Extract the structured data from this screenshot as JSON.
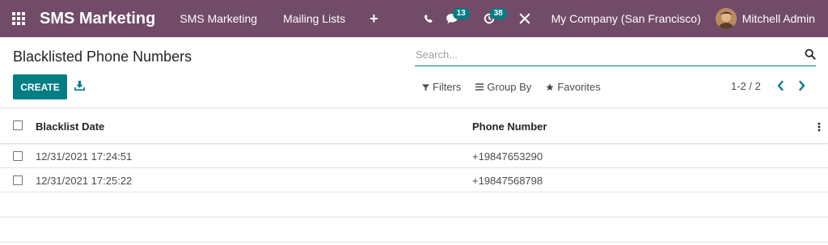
{
  "navbar": {
    "app_title": "SMS Marketing",
    "menu": [
      "SMS Marketing",
      "Mailing Lists"
    ],
    "plus_label": "+",
    "messages_count": "13",
    "activities_count": "38",
    "company": "My Company (San Francisco)",
    "user_name": "Mitchell Admin"
  },
  "control_panel": {
    "title": "Blacklisted Phone Numbers",
    "search_placeholder": "Search...",
    "create_label": "CREATE",
    "filters_label": "Filters",
    "group_by_label": "Group By",
    "favorites_label": "Favorites",
    "pager": "1-2 / 2"
  },
  "list": {
    "columns": [
      "Blacklist Date",
      "Phone Number"
    ],
    "rows": [
      {
        "date": "12/31/2021 17:24:51",
        "phone": "+19847653290"
      },
      {
        "date": "12/31/2021 17:25:22",
        "phone": "+19847568798"
      }
    ]
  },
  "colors": {
    "navbar": "#714b67",
    "primary": "#017e84",
    "badge": "#017e84"
  }
}
